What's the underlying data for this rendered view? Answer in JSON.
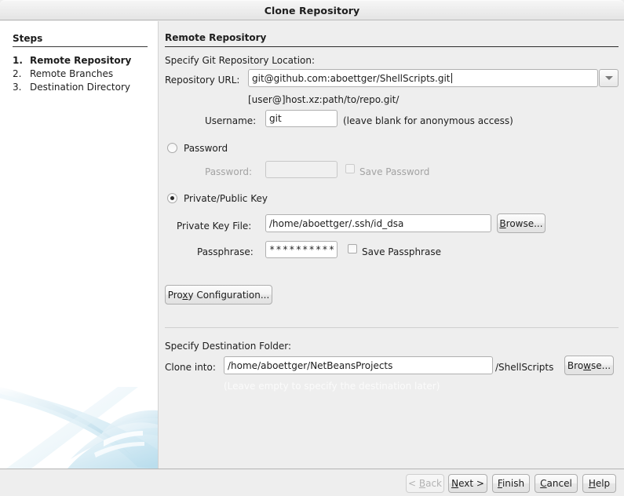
{
  "window": {
    "title": "Clone Repository"
  },
  "sidebar": {
    "heading": "Steps",
    "items": [
      {
        "num": "1.",
        "label": "Remote Repository",
        "current": true
      },
      {
        "num": "2.",
        "label": "Remote Branches",
        "current": false
      },
      {
        "num": "3.",
        "label": "Destination Directory",
        "current": false
      }
    ]
  },
  "main": {
    "section_title": "Remote Repository",
    "specify_location_label": "Specify Git Repository Location:",
    "repository_url": {
      "label": "Repository URL:",
      "value": "git@github.com:aboettger/ShellScripts.git",
      "placeholder": "",
      "dropdown_icon": "chevron-down-icon",
      "format_hint": "[user@]host.xz:path/to/repo.git/"
    },
    "username": {
      "label": "Username:",
      "value": "git",
      "hint": "(leave blank for anonymous access)"
    },
    "auth": {
      "password_option": {
        "label": "Password",
        "mnemonic": "w",
        "selected": false,
        "password_field_label": "Password:",
        "password_value": "",
        "save_password_label": "Save Password",
        "save_password_mnemonic": "S",
        "save_password_checked": false,
        "enabled": false
      },
      "key_option": {
        "label": "Private/Public Key",
        "mnemonic": "K",
        "selected": true,
        "private_key_label": "Private Key File:",
        "private_key_value": "/home/aboettger/.ssh/id_dsa",
        "browse_label": "Browse...",
        "browse_mnemonic": "B",
        "passphrase_label": "Passphrase:",
        "passphrase_value": "**********",
        "save_passphrase_label": "Save Passphrase",
        "save_passphrase_mnemonic": "S",
        "save_passphrase_checked": false
      }
    },
    "proxy_button": {
      "label": "Proxy Configuration...",
      "mnemonic": "x"
    },
    "destination": {
      "section_label": "Specify Destination Folder:",
      "clone_into_label": "Clone into:",
      "clone_into_value": "/home/aboettger/NetBeansProjects",
      "suffix": "/ShellScripts",
      "browse_label": "Browse...",
      "browse_mnemonic": "w",
      "empty_hint": "(Leave empty to specify the destination later)"
    }
  },
  "footer": {
    "buttons": [
      {
        "name": "back",
        "label": "< Back",
        "mnemonic": "B",
        "enabled": false
      },
      {
        "name": "next",
        "label": "Next >",
        "mnemonic": "N",
        "enabled": true
      },
      {
        "name": "finish",
        "label": "Finish",
        "mnemonic": "F",
        "enabled": true
      },
      {
        "name": "cancel",
        "label": "Cancel",
        "mnemonic": "C",
        "enabled": true
      },
      {
        "name": "help",
        "label": "Help",
        "mnemonic": "H",
        "enabled": true
      }
    ]
  },
  "colors": {
    "window_bg": "#eeeeee",
    "panel_bg": "#ffffff",
    "text": "#1d1d1d",
    "disabled_text": "#a3a3a3",
    "field_border": "#b0b0b0",
    "accent_artwork": "#bcdcea"
  }
}
